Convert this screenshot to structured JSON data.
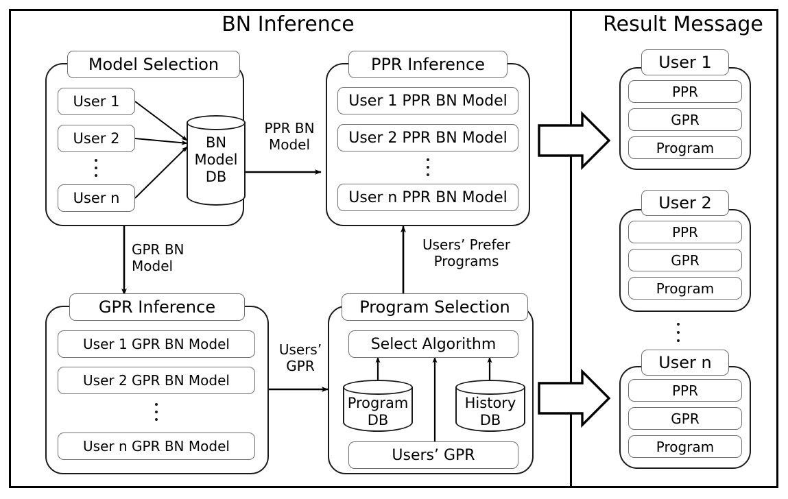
{
  "diagram": {
    "panels": [
      {
        "id": "bn",
        "title": "BN Inference"
      },
      {
        "id": "result",
        "title": "Result Message"
      }
    ]
  },
  "model_selection": {
    "title": "Model Selection",
    "users": [
      "User 1",
      "User 2",
      "User n"
    ],
    "ellipsis": "vertical-ellipsis",
    "db": {
      "label_line1": "BN",
      "label_line2": "Model",
      "label_line3": "DB"
    }
  },
  "ppr_inference": {
    "title": "PPR Inference",
    "models": [
      "User 1 PPR BN Model",
      "User 2 PPR BN Model",
      "User n PPR BN Model"
    ],
    "ellipsis": "vertical-ellipsis"
  },
  "gpr_inference": {
    "title": "GPR Inference",
    "models": [
      "User  1 GPR BN Model",
      "User  2 GPR BN Model",
      "User  n GPR BN Model"
    ],
    "ellipsis": "vertical-ellipsis"
  },
  "program_selection": {
    "title": "Program Selection",
    "select_algorithm": "Select Algorithm",
    "program_db": {
      "label_line1": "Program",
      "label_line2": "DB"
    },
    "history_db": {
      "label_line1": "History",
      "label_line2": "DB"
    },
    "users_gpr": "Users’ GPR"
  },
  "connectors": {
    "ppr_bn_model": "PPR BN\nModel",
    "gpr_bn_model": "GPR BN\nModel",
    "users_prefer_programs": "Users’ Prefer\nPrograms",
    "users_gpr": "Users’\nGPR"
  },
  "result_message": {
    "cards": [
      {
        "title": "User 1",
        "items": [
          "PPR",
          "GPR",
          "Program"
        ]
      },
      {
        "title": "User 2",
        "items": [
          "PPR",
          "GPR",
          "Program"
        ]
      },
      {
        "title": "User n",
        "items": [
          "PPR",
          "GPR",
          "Program"
        ]
      }
    ],
    "ellipsis": "vertical-ellipsis"
  },
  "colors": {
    "stroke": "#000000",
    "module_stroke": "#1a1a1a",
    "pill_stroke": "#6f6f6f",
    "background": "#ffffff"
  }
}
